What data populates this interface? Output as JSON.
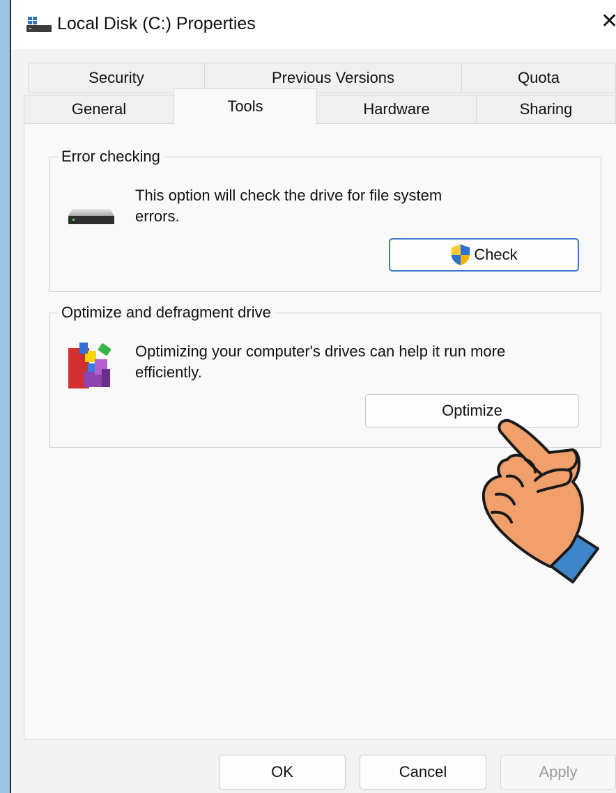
{
  "window": {
    "title": "Local Disk (C:) Properties",
    "close_glyph": "✕"
  },
  "tabs": {
    "row1": [
      "Security",
      "Previous Versions",
      "Quota"
    ],
    "row2": [
      "General",
      "Tools",
      "Hardware",
      "Sharing"
    ],
    "active": "Tools"
  },
  "error_checking": {
    "legend": "Error checking",
    "line1": "This option will check the drive for file system",
    "line2": "errors.",
    "button": "Check",
    "icon": "drive-icon"
  },
  "optimize": {
    "legend": "Optimize and defragment drive",
    "line1": "Optimizing your computer's drives can help it run more",
    "line2": "efficiently.",
    "button": "Optimize",
    "icon": "defrag-icon"
  },
  "footer": {
    "ok": "OK",
    "cancel": "Cancel",
    "apply": "Apply"
  },
  "colors": {
    "accent": "#3b77c6",
    "background": "#9dc3e6"
  }
}
